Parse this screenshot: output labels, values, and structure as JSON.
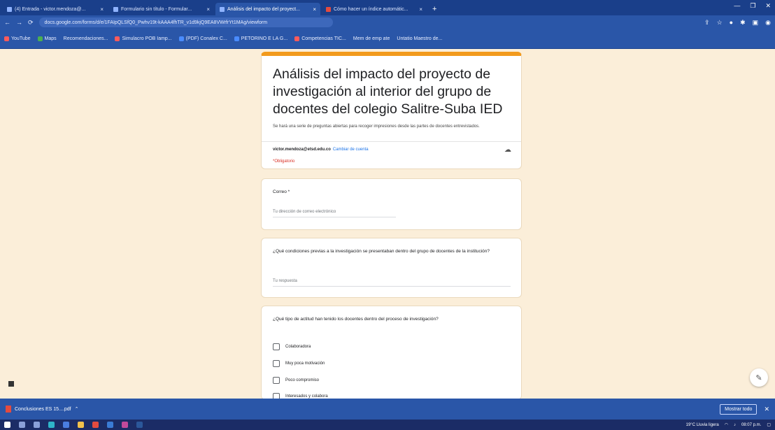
{
  "browser": {
    "tabs": [
      {
        "title": "(4) Entrada - victor.mendoza@...",
        "active": false
      },
      {
        "title": "Formulario sin título - Formular...",
        "active": false
      },
      {
        "title": "Análisis del impacto del proyect...",
        "active": true
      },
      {
        "title": "Cómo hacer un índice automátic...",
        "active": false
      }
    ],
    "new_tab": "+",
    "url": "docs.google.com/forms/d/e/1FAIpQLSfQ0_Pwhv19t-kAAA4fhTR_v1d9kjQ9EA8VWrfrYt1MAg/viewform",
    "bookmarks": [
      "YouTube",
      "Maps",
      "Recomendaciones...",
      "Simulacro POB Iamp...",
      "(PDF) Conalex C...",
      "PETORINO E LA G...",
      "Competencias TIC...",
      "Mem de emp ate",
      "Untatio Maestro de..."
    ]
  },
  "form": {
    "title": "Análisis del impacto del proyecto de investigación al interior del grupo de docentes del colegio Salitre-Suba IED",
    "description": "Se hará una serie de preguntas abiertas para recoger impresiones desde las partes de docentes entrevistados.",
    "account_email": "victor.mendoza@etsd.edu.co",
    "switch_account": "Cambiar de cuenta",
    "required_note": "*Obligatorio",
    "questions": [
      {
        "label": "Correo *",
        "placeholder": "Tu dirección de correo electrónico"
      },
      {
        "label": "¿Qué condiciones previas a la investigación se presentaban dentro del grupo de docentes de la institución?",
        "placeholder": "Tu respuesta"
      },
      {
        "label": "¿Qué tipo de actitud han tenido los docentes dentro del proceso de investigación?",
        "options": [
          "Colaboradora",
          "Muy poca motivación",
          "Poco compromiso",
          "Interesados y colabora"
        ]
      }
    ]
  },
  "download": {
    "file_name": "Conclusiones ES 15....pdf",
    "show_all": "Mostrar todo"
  },
  "taskbar": {
    "weather": "19°C Lluvia ligera",
    "time": "08:07 p.m."
  }
}
